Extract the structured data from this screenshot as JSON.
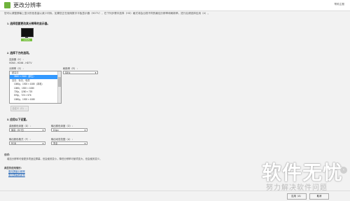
{
  "header": {
    "title": "更改分辨率",
    "help": "帮助主题"
  },
  "intro": "您可以调整屏幕上显示的信息量以减少闪烁。如果您正在使用数字平板显示器（HDTV），在下列步骤中选择（HD）格式将会出现不同的最佳分辨率和刷新率。进行后请选择应用（A）。",
  "step1": {
    "title": "1.  选择您要更改其分辨率的显示器。",
    "monitor_label": "1.NVS"
  },
  "step2": {
    "title": "2.  选择下方的选项。",
    "connector_label": "连接器（K）：",
    "connector_value": "HDMI - HDMI - HDTV",
    "resolution_label": "分辨率（S）：",
    "refresh_label": "刷新率（R）：",
    "refresh_value": "50Hz",
    "list": [
      {
        "text": "超高清",
        "group": true,
        "selected": false
      },
      {
        "text": "3840 × 2160（原生）",
        "group": false,
        "selected": true
      },
      {
        "text": "高清、标清、电视",
        "group": true,
        "selected": false
      },
      {
        "text": "1080p，1920 × 1080（本机）",
        "group": false,
        "selected": false
      },
      {
        "text": "1080i，1920 × 1080",
        "group": false,
        "selected": false
      },
      {
        "text": "720p，1280 × 720",
        "group": false,
        "selected": false
      },
      {
        "text": "576p，720 × 576",
        "group": false,
        "selected": false
      },
      {
        "text": "1080p，1920 × 1080",
        "group": false,
        "selected": false
      }
    ],
    "custom_button": "自定义（D）..."
  },
  "step3": {
    "title": "3.  应用以下设置。",
    "color_format_label": "桌面颜色深度（D）：",
    "color_format_value": "最高（32 位）",
    "output_depth_label": "输出颜色深度（O）：",
    "output_depth_value": "8 bpc",
    "output_format_label": "输出颜色格式（F）：",
    "output_format_value": "RGB",
    "dynamic_range_label": "输出动态范围（U）：",
    "dynamic_range_value": "完全"
  },
  "description": {
    "title": "说明：",
    "text": "增加分辨率可使更多项适应屏幕，但会使其变小。降低分辨率可使项变大，但会使其变少。"
  },
  "typical": {
    "title": "典型的使用情形：",
    "items": [
      "更改屏幕分辨率",
      "更改屏幕刷新率"
    ]
  },
  "footer": {
    "apply": "应用（A）",
    "cancel": "取消"
  },
  "watermark": {
    "main": "软件无忧",
    "sub": "努力解决软件问题"
  }
}
